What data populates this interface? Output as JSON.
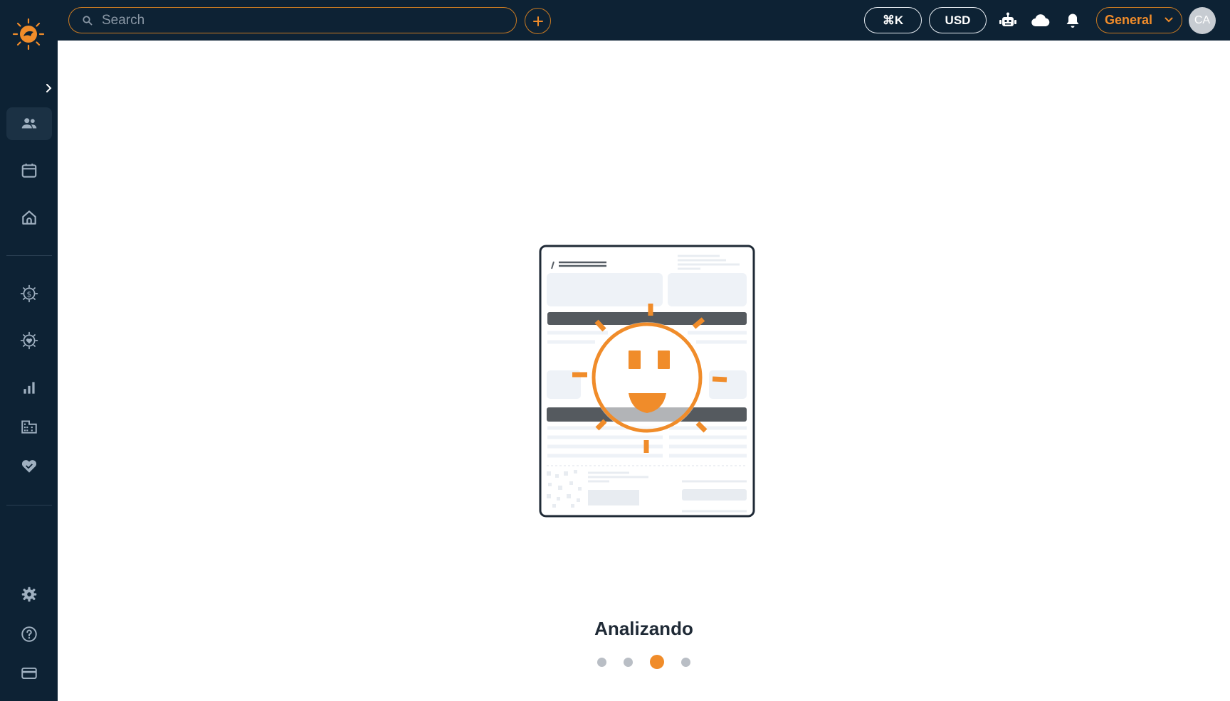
{
  "topbar": {
    "search_placeholder": "Search",
    "shortcut_label": "⌘K",
    "currency_label": "USD",
    "workspace_label": "General",
    "avatar_initials": "CA"
  },
  "sidebar": {
    "items": [
      {
        "icon": "people-icon",
        "active": true
      },
      {
        "icon": "calendar-icon",
        "active": false
      },
      {
        "icon": "home-icon",
        "active": false
      },
      {
        "icon": "dollar-sun-icon",
        "active": false
      },
      {
        "icon": "heart-sun-icon",
        "active": false
      },
      {
        "icon": "bar-chart-icon",
        "active": false
      },
      {
        "icon": "building-icon",
        "active": false
      },
      {
        "icon": "handshake-icon",
        "active": false
      },
      {
        "icon": "settings-icon",
        "active": false
      },
      {
        "icon": "help-icon",
        "active": false
      },
      {
        "icon": "credit-card-icon",
        "active": false
      }
    ]
  },
  "main": {
    "status_text": "Analizando",
    "progress": {
      "total_steps": 4,
      "active_step": 3
    }
  },
  "colors": {
    "navy": "#0d2234",
    "accent": "#f08c2a",
    "text_dark": "#1f2a36"
  }
}
